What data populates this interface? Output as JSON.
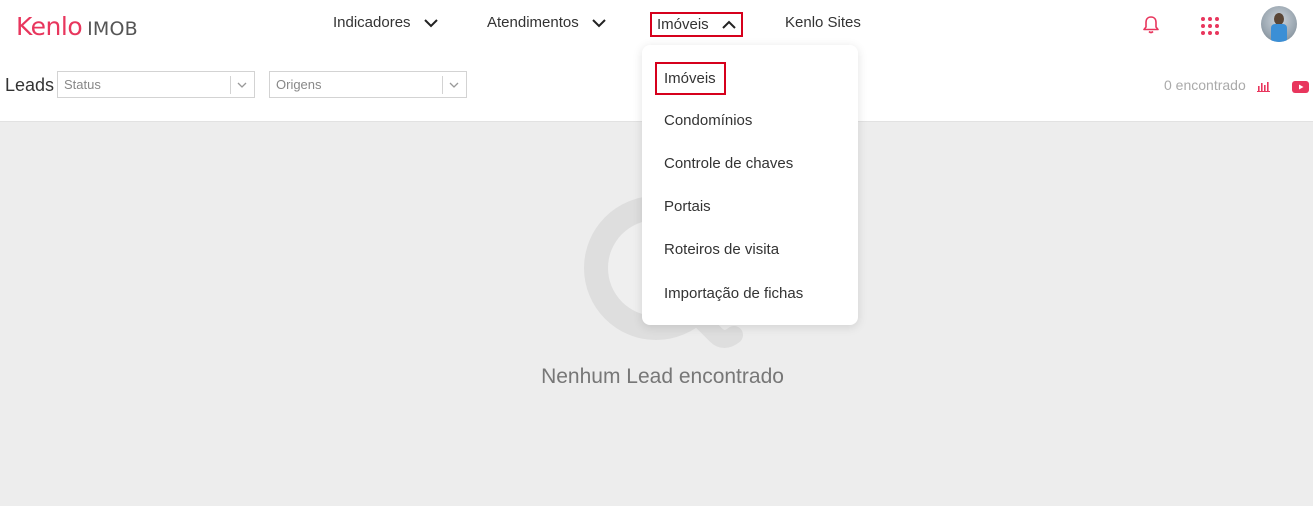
{
  "brand": {
    "name": "Kenlo",
    "product": "IMOB",
    "accent": "#e8365d"
  },
  "nav": {
    "items": [
      {
        "label": "Indicadores",
        "has_chevron": true
      },
      {
        "label": "Atendimentos",
        "has_chevron": true
      },
      {
        "label": "Imóveis",
        "has_chevron": true,
        "expanded": true
      },
      {
        "label": "Kenlo Sites",
        "has_chevron": false
      }
    ],
    "icons": [
      "bell-icon",
      "apps-grid-icon",
      "user-avatar"
    ]
  },
  "filters": {
    "title": "Leads",
    "status_placeholder": "Status",
    "origens_placeholder": "Origens",
    "count_text": "0 encontrado",
    "icons": [
      "chart-bar-icon",
      "youtube-icon"
    ]
  },
  "dropdown": {
    "items": [
      {
        "label": "Imóveis",
        "selected": true
      },
      {
        "label": "Condomínios"
      },
      {
        "label": "Controle de chaves"
      },
      {
        "label": "Portais"
      },
      {
        "label": "Roteiros de visita"
      },
      {
        "label": "Importação de fichas"
      }
    ]
  },
  "empty_state": {
    "message": "Nenhum Lead encontrado"
  },
  "colors": {
    "highlight_border": "#d6001c",
    "background": "#ededed"
  }
}
